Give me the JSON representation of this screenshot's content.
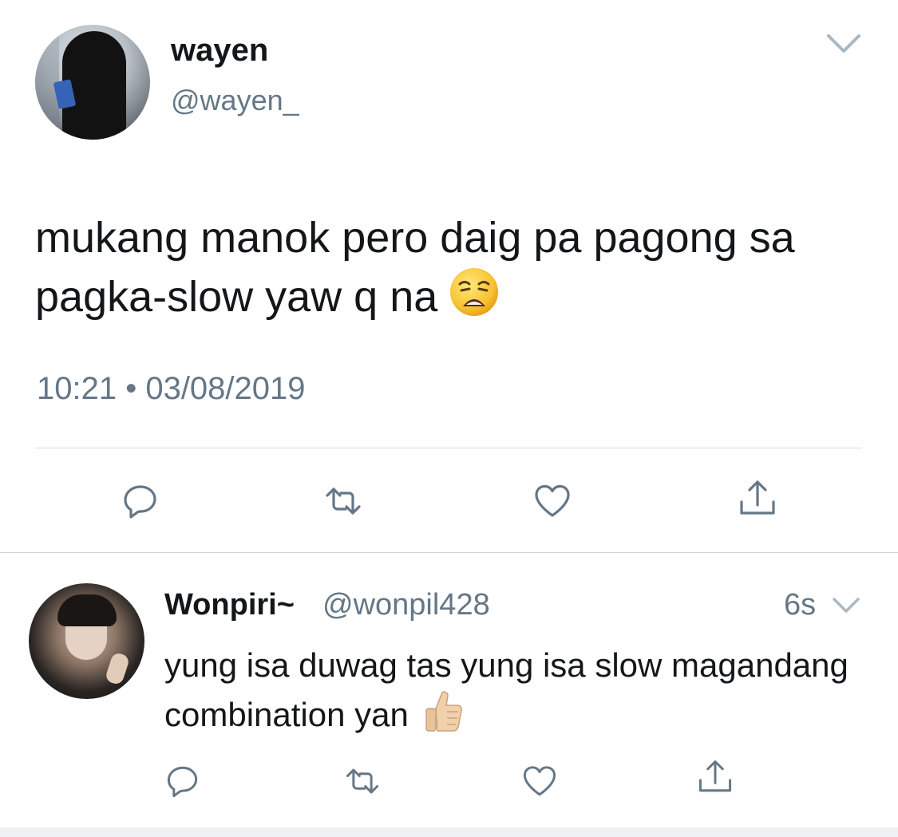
{
  "main_tweet": {
    "display_name": "wayen",
    "handle": "@wayen_",
    "text": "mukang manok pero daig pa pagong sa pagka-slow yaw q na",
    "emoji": "weary-face-emoji",
    "timestamp": "10:21 • 03/08/2019",
    "actions": [
      "reply-icon",
      "retweet-icon",
      "like-icon",
      "share-icon"
    ]
  },
  "reply_tweet": {
    "display_name": "Wonpiri~",
    "handle": "@wonpil428",
    "time_ago": "6s",
    "text": "yung isa duwag tas yung isa slow magandang combination yan",
    "emoji": "thumbs-up-emoji",
    "actions": [
      "reply-icon",
      "retweet-icon",
      "like-icon",
      "share-icon"
    ]
  },
  "colors": {
    "text_primary": "#14171a",
    "text_secondary": "#657786",
    "divider": "#d8dde2",
    "icon": "#657786"
  }
}
